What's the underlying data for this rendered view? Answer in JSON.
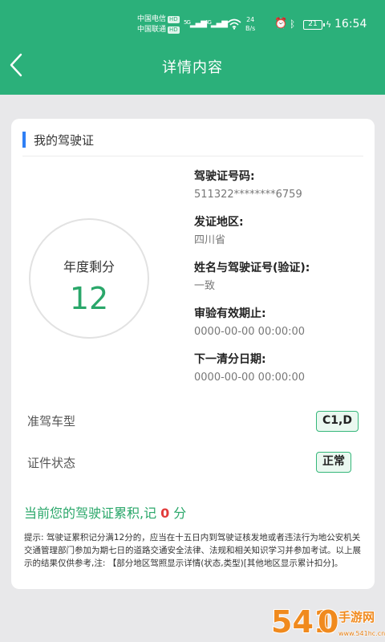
{
  "status_bar": {
    "carrier_1": "中国电信",
    "carrier_2": "中国联通",
    "hd_badge": "HD",
    "net_5g": "5G",
    "net_4g": "4G",
    "speed_value": "24",
    "speed_unit": "B/s",
    "battery": "21",
    "time": "16:54"
  },
  "header": {
    "title": "详情内容"
  },
  "card": {
    "section_title": "我的驾驶证",
    "points": {
      "label": "年度剩分",
      "value": "12"
    },
    "info": [
      {
        "label": "驾驶证号码:",
        "value": "511322********6759"
      },
      {
        "label": "发证地区:",
        "value": "四川省"
      },
      {
        "label": "姓名与驾驶证号(验证):",
        "value": "一致"
      },
      {
        "label": "审验有效期止:",
        "value": "0000-00-00 00:00:00"
      },
      {
        "label": "下一清分日期:",
        "value": "0000-00-00 00:00:00"
      }
    ],
    "vehicle_type": {
      "label": "准驾车型",
      "value": "C1,D"
    },
    "license_status": {
      "label": "证件状态",
      "value": "正常"
    },
    "summary": {
      "prefix": "当前您的驾驶证累积,记",
      "points": "0",
      "suffix": "分"
    },
    "notice": "提示: 驾驶证累积记分满12分的，应当在十五日内到驾驶证核发地或者违法行为地公安机关交通管理部门参加为期七日的道路交通安全法律、法规和相关知识学习并参加考试。以上展示的结果仅供参考,注: 【部分地区驾照显示详情(状态,类型)[其他地区显示累计扣分]。"
  },
  "watermark": {
    "logo_text": "5410手游网",
    "site": "www.541hc.cn"
  },
  "colors": {
    "brand_green": "#2bb07a",
    "points_green": "#2aa76a",
    "accent_blue": "#2f7ff5",
    "alert_red": "#e23b3b"
  }
}
